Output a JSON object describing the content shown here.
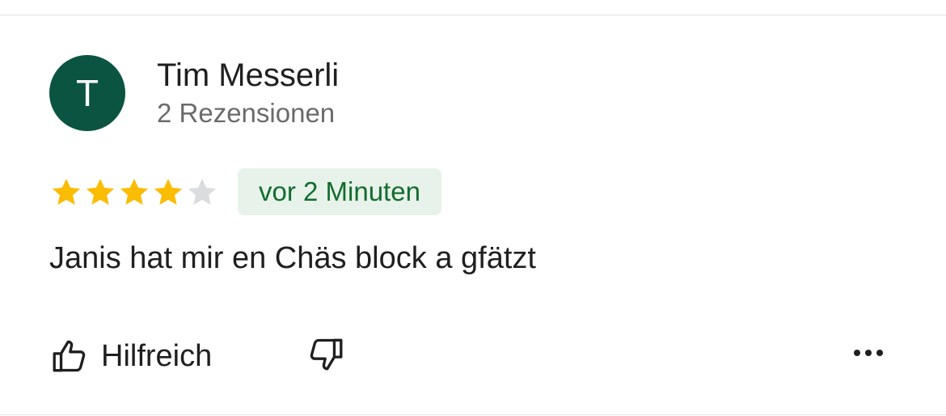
{
  "reviewer": {
    "avatar_initial": "T",
    "avatar_color": "#0b5442",
    "name": "Tim Messerli",
    "review_count": "2 Rezensionen"
  },
  "rating": {
    "value": 4,
    "max": 5,
    "filled_color": "#fbbc04",
    "empty_color": "#dadce0"
  },
  "time_badge": "vor 2 Minuten",
  "review_text": "Janis hat mir en Chäs block a gfätzt",
  "actions": {
    "helpful_label": "Hilfreich",
    "helpful_icon": "thumbs-up-icon",
    "unhelpful_icon": "thumbs-down-icon",
    "more_icon": "more-horizontal-icon"
  }
}
